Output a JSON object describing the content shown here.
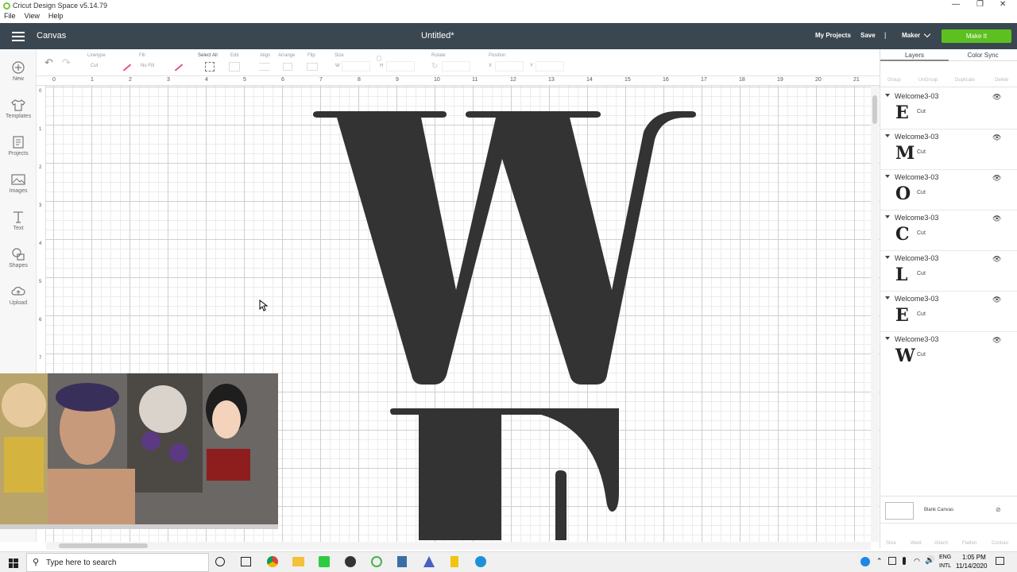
{
  "window": {
    "title": "Cricut Design Space  v5.14.79"
  },
  "menu": [
    "File",
    "View",
    "Help"
  ],
  "header": {
    "section": "Canvas",
    "doc_title": "Untitled*",
    "my_projects": "My Projects",
    "save": "Save",
    "separator": "|",
    "machine": "Maker",
    "make_it": "Make It"
  },
  "toolbar": {
    "select_all": "Select All",
    "labels": {
      "linetype": "Linetype",
      "linetype_value": "Cut",
      "fill": "Fill",
      "fill_value": "No Fill",
      "edit": "Edit",
      "align": "Align",
      "arrange": "Arrange",
      "flip": "Flip",
      "size": "Size",
      "size_w": "W",
      "size_h": "H",
      "rotate": "Rotate",
      "position": "Position",
      "pos_x": "X",
      "pos_y": "Y"
    }
  },
  "nav": [
    {
      "label": "New",
      "icon": "plus-circle-icon"
    },
    {
      "label": "Templates",
      "icon": "shirt-icon"
    },
    {
      "label": "Projects",
      "icon": "projects-icon"
    },
    {
      "label": "Images",
      "icon": "image-icon"
    },
    {
      "label": "Text",
      "icon": "text-icon"
    },
    {
      "label": "Shapes",
      "icon": "shapes-icon"
    },
    {
      "label": "Upload",
      "icon": "upload-cloud-icon"
    }
  ],
  "ruler_top": [
    "0",
    "1",
    "2",
    "3",
    "4",
    "5",
    "6",
    "7",
    "8",
    "9",
    "10",
    "11",
    "12",
    "13",
    "14",
    "15",
    "16",
    "17",
    "18",
    "19",
    "20",
    "21"
  ],
  "ruler_left": [
    "0",
    "1",
    "2",
    "3",
    "4",
    "5",
    "6",
    "7"
  ],
  "panel": {
    "tabs": [
      "Layers",
      "Color Sync"
    ],
    "actions": [
      "Group",
      "UnGroup",
      "Duplicate",
      "Delete"
    ],
    "layers": [
      {
        "name": "Welcome3-03",
        "glyph": "E",
        "op": "Cut"
      },
      {
        "name": "Welcome3-03",
        "glyph": "M",
        "op": "Cut"
      },
      {
        "name": "Welcome3-03",
        "glyph": "O",
        "op": "Cut"
      },
      {
        "name": "Welcome3-03",
        "glyph": "C",
        "op": "Cut"
      },
      {
        "name": "Welcome3-03",
        "glyph": "L",
        "op": "Cut"
      },
      {
        "name": "Welcome3-03",
        "glyph": "E",
        "op": "Cut"
      },
      {
        "name": "Welcome3-03",
        "glyph": "W",
        "op": "Cut"
      }
    ],
    "blank_canvas": "Blank Canvas",
    "bottom_actions": [
      "Slice",
      "Weld",
      "Attach",
      "Flatten",
      "Contour"
    ]
  },
  "taskbar": {
    "search_placeholder": "Type here to search",
    "lang1": "ENG",
    "lang2": "INTL",
    "time": "1:05 PM",
    "date": "11/14/2020"
  },
  "colors": {
    "header_bg": "#3b4750",
    "make_it": "#5cc020",
    "letter": "#333333"
  }
}
